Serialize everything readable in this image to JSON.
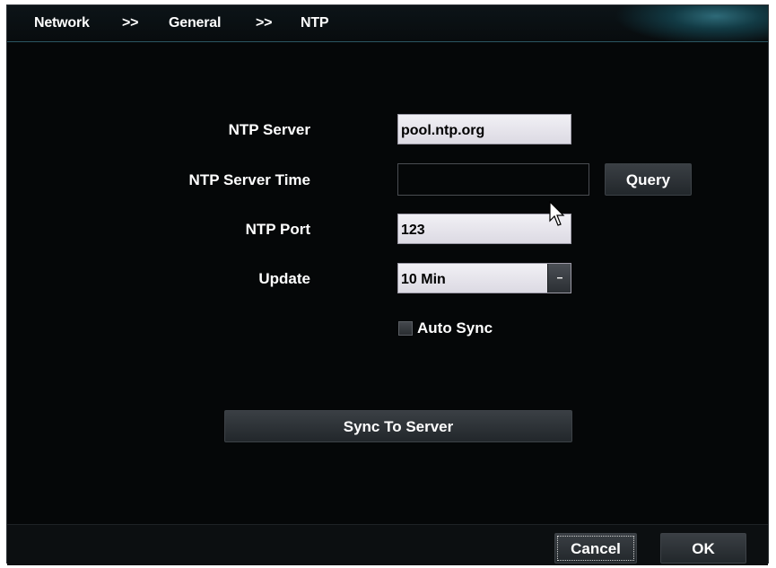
{
  "breadcrumb": {
    "items": [
      "Network",
      "General",
      "NTP"
    ],
    "separator": ">>"
  },
  "form": {
    "ntp_server": {
      "label": "NTP Server",
      "value": "pool.ntp.org"
    },
    "ntp_server_time": {
      "label": "NTP Server Time",
      "value": ""
    },
    "query_button": "Query",
    "ntp_port": {
      "label": "NTP Port",
      "value": "123"
    },
    "update": {
      "label": "Update",
      "value": "10 Min"
    },
    "auto_sync": {
      "label": "Auto Sync",
      "checked": false
    },
    "sync_button": "Sync To Server"
  },
  "footer": {
    "cancel_label": "Cancel",
    "ok_label": "OK"
  },
  "colors": {
    "background": "#050708",
    "accent": "#2e6a78",
    "field": "#e6e4ec"
  }
}
